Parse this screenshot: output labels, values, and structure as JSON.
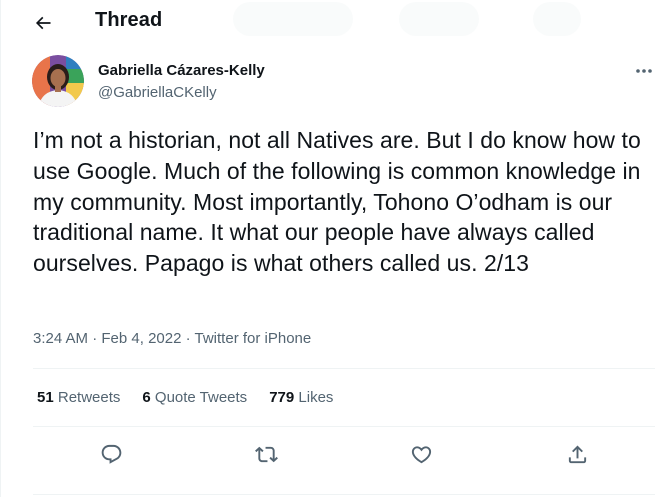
{
  "header": {
    "back_icon": "arrow-left-icon",
    "title": "Thread"
  },
  "tweet": {
    "author_name": "Gabriella Cázares-Kelly",
    "author_handle": "@GabriellaCKelly",
    "more_icon": "more-dots-icon",
    "text": "I’m not a historian, not all Natives are. But I do know how to use Google. Much of the following is common knowledge in my community. Most importantly, Tohono O’odham is our traditional name. It what our people have always called ourselves. Papago is what others called us. 2/13",
    "time": "3:24 AM",
    "separator1": " · ",
    "date": "Feb 4, 2022",
    "separator2": " · ",
    "source": "Twitter for iPhone"
  },
  "stats": {
    "retweets_count": "51",
    "retweets_label": "Retweets",
    "quotes_count": "6",
    "quotes_label": "Quote Tweets",
    "likes_count": "779",
    "likes_label": "Likes"
  },
  "actions": {
    "reply_icon": "reply-icon",
    "retweet_icon": "retweet-icon",
    "like_icon": "heart-icon",
    "share_icon": "share-icon"
  },
  "colors": {
    "text_primary": "#0f1419",
    "text_secondary": "#536471",
    "divider": "#eff3f4"
  }
}
